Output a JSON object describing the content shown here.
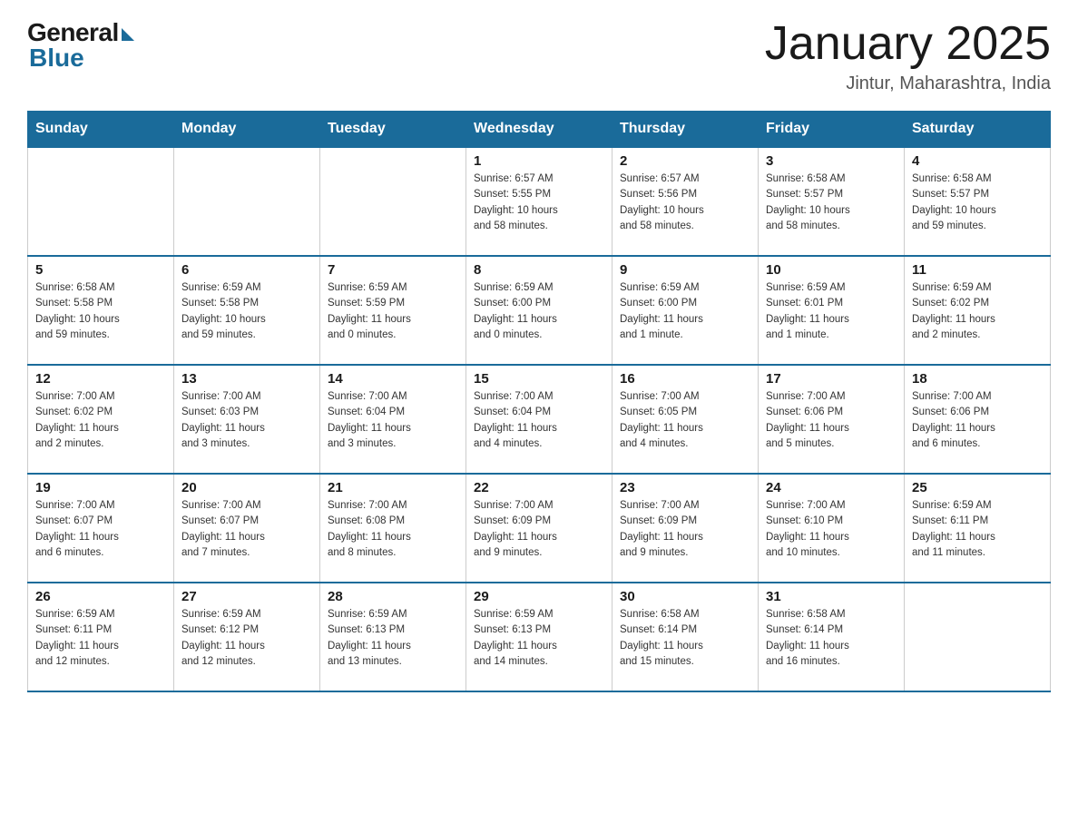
{
  "header": {
    "logo_general": "General",
    "logo_blue": "Blue",
    "month_title": "January 2025",
    "location": "Jintur, Maharashtra, India"
  },
  "weekdays": [
    "Sunday",
    "Monday",
    "Tuesday",
    "Wednesday",
    "Thursday",
    "Friday",
    "Saturday"
  ],
  "weeks": [
    [
      {
        "day": "",
        "info": ""
      },
      {
        "day": "",
        "info": ""
      },
      {
        "day": "",
        "info": ""
      },
      {
        "day": "1",
        "info": "Sunrise: 6:57 AM\nSunset: 5:55 PM\nDaylight: 10 hours\nand 58 minutes."
      },
      {
        "day": "2",
        "info": "Sunrise: 6:57 AM\nSunset: 5:56 PM\nDaylight: 10 hours\nand 58 minutes."
      },
      {
        "day": "3",
        "info": "Sunrise: 6:58 AM\nSunset: 5:57 PM\nDaylight: 10 hours\nand 58 minutes."
      },
      {
        "day": "4",
        "info": "Sunrise: 6:58 AM\nSunset: 5:57 PM\nDaylight: 10 hours\nand 59 minutes."
      }
    ],
    [
      {
        "day": "5",
        "info": "Sunrise: 6:58 AM\nSunset: 5:58 PM\nDaylight: 10 hours\nand 59 minutes."
      },
      {
        "day": "6",
        "info": "Sunrise: 6:59 AM\nSunset: 5:58 PM\nDaylight: 10 hours\nand 59 minutes."
      },
      {
        "day": "7",
        "info": "Sunrise: 6:59 AM\nSunset: 5:59 PM\nDaylight: 11 hours\nand 0 minutes."
      },
      {
        "day": "8",
        "info": "Sunrise: 6:59 AM\nSunset: 6:00 PM\nDaylight: 11 hours\nand 0 minutes."
      },
      {
        "day": "9",
        "info": "Sunrise: 6:59 AM\nSunset: 6:00 PM\nDaylight: 11 hours\nand 1 minute."
      },
      {
        "day": "10",
        "info": "Sunrise: 6:59 AM\nSunset: 6:01 PM\nDaylight: 11 hours\nand 1 minute."
      },
      {
        "day": "11",
        "info": "Sunrise: 6:59 AM\nSunset: 6:02 PM\nDaylight: 11 hours\nand 2 minutes."
      }
    ],
    [
      {
        "day": "12",
        "info": "Sunrise: 7:00 AM\nSunset: 6:02 PM\nDaylight: 11 hours\nand 2 minutes."
      },
      {
        "day": "13",
        "info": "Sunrise: 7:00 AM\nSunset: 6:03 PM\nDaylight: 11 hours\nand 3 minutes."
      },
      {
        "day": "14",
        "info": "Sunrise: 7:00 AM\nSunset: 6:04 PM\nDaylight: 11 hours\nand 3 minutes."
      },
      {
        "day": "15",
        "info": "Sunrise: 7:00 AM\nSunset: 6:04 PM\nDaylight: 11 hours\nand 4 minutes."
      },
      {
        "day": "16",
        "info": "Sunrise: 7:00 AM\nSunset: 6:05 PM\nDaylight: 11 hours\nand 4 minutes."
      },
      {
        "day": "17",
        "info": "Sunrise: 7:00 AM\nSunset: 6:06 PM\nDaylight: 11 hours\nand 5 minutes."
      },
      {
        "day": "18",
        "info": "Sunrise: 7:00 AM\nSunset: 6:06 PM\nDaylight: 11 hours\nand 6 minutes."
      }
    ],
    [
      {
        "day": "19",
        "info": "Sunrise: 7:00 AM\nSunset: 6:07 PM\nDaylight: 11 hours\nand 6 minutes."
      },
      {
        "day": "20",
        "info": "Sunrise: 7:00 AM\nSunset: 6:07 PM\nDaylight: 11 hours\nand 7 minutes."
      },
      {
        "day": "21",
        "info": "Sunrise: 7:00 AM\nSunset: 6:08 PM\nDaylight: 11 hours\nand 8 minutes."
      },
      {
        "day": "22",
        "info": "Sunrise: 7:00 AM\nSunset: 6:09 PM\nDaylight: 11 hours\nand 9 minutes."
      },
      {
        "day": "23",
        "info": "Sunrise: 7:00 AM\nSunset: 6:09 PM\nDaylight: 11 hours\nand 9 minutes."
      },
      {
        "day": "24",
        "info": "Sunrise: 7:00 AM\nSunset: 6:10 PM\nDaylight: 11 hours\nand 10 minutes."
      },
      {
        "day": "25",
        "info": "Sunrise: 6:59 AM\nSunset: 6:11 PM\nDaylight: 11 hours\nand 11 minutes."
      }
    ],
    [
      {
        "day": "26",
        "info": "Sunrise: 6:59 AM\nSunset: 6:11 PM\nDaylight: 11 hours\nand 12 minutes."
      },
      {
        "day": "27",
        "info": "Sunrise: 6:59 AM\nSunset: 6:12 PM\nDaylight: 11 hours\nand 12 minutes."
      },
      {
        "day": "28",
        "info": "Sunrise: 6:59 AM\nSunset: 6:13 PM\nDaylight: 11 hours\nand 13 minutes."
      },
      {
        "day": "29",
        "info": "Sunrise: 6:59 AM\nSunset: 6:13 PM\nDaylight: 11 hours\nand 14 minutes."
      },
      {
        "day": "30",
        "info": "Sunrise: 6:58 AM\nSunset: 6:14 PM\nDaylight: 11 hours\nand 15 minutes."
      },
      {
        "day": "31",
        "info": "Sunrise: 6:58 AM\nSunset: 6:14 PM\nDaylight: 11 hours\nand 16 minutes."
      },
      {
        "day": "",
        "info": ""
      }
    ]
  ]
}
